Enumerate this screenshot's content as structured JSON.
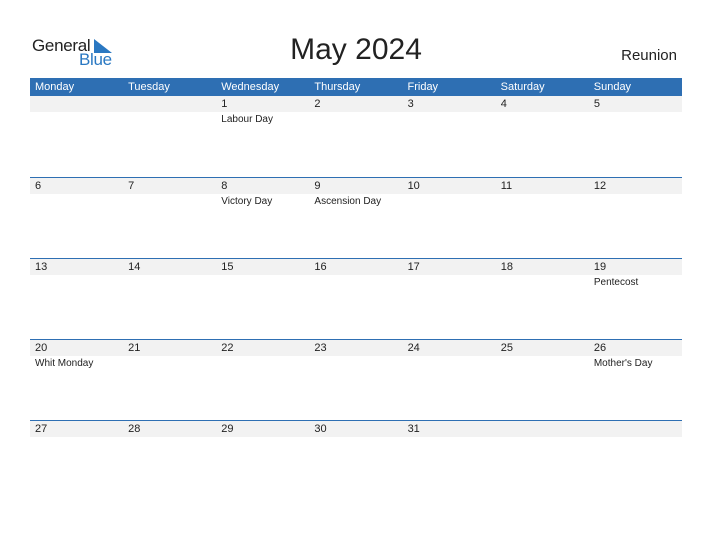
{
  "logo": {
    "general": "General",
    "blue": "Blue"
  },
  "title": "May 2024",
  "country": "Reunion",
  "colors": {
    "accent": "#2e6fb3",
    "logo_blue": "#2a78c2",
    "row_strip": "#f2f2f2"
  },
  "weekdays": [
    "Monday",
    "Tuesday",
    "Wednesday",
    "Thursday",
    "Friday",
    "Saturday",
    "Sunday"
  ],
  "weeks": [
    {
      "days": [
        {
          "num": "",
          "holiday": ""
        },
        {
          "num": "",
          "holiday": ""
        },
        {
          "num": "1",
          "holiday": "Labour Day"
        },
        {
          "num": "2",
          "holiday": ""
        },
        {
          "num": "3",
          "holiday": ""
        },
        {
          "num": "4",
          "holiday": ""
        },
        {
          "num": "5",
          "holiday": ""
        }
      ]
    },
    {
      "days": [
        {
          "num": "6",
          "holiday": ""
        },
        {
          "num": "7",
          "holiday": ""
        },
        {
          "num": "8",
          "holiday": "Victory Day"
        },
        {
          "num": "9",
          "holiday": "Ascension Day"
        },
        {
          "num": "10",
          "holiday": ""
        },
        {
          "num": "11",
          "holiday": ""
        },
        {
          "num": "12",
          "holiday": ""
        }
      ]
    },
    {
      "days": [
        {
          "num": "13",
          "holiday": ""
        },
        {
          "num": "14",
          "holiday": ""
        },
        {
          "num": "15",
          "holiday": ""
        },
        {
          "num": "16",
          "holiday": ""
        },
        {
          "num": "17",
          "holiday": ""
        },
        {
          "num": "18",
          "holiday": ""
        },
        {
          "num": "19",
          "holiday": "Pentecost"
        }
      ]
    },
    {
      "days": [
        {
          "num": "20",
          "holiday": "Whit Monday"
        },
        {
          "num": "21",
          "holiday": ""
        },
        {
          "num": "22",
          "holiday": ""
        },
        {
          "num": "23",
          "holiday": ""
        },
        {
          "num": "24",
          "holiday": ""
        },
        {
          "num": "25",
          "holiday": ""
        },
        {
          "num": "26",
          "holiday": "Mother's Day"
        }
      ]
    },
    {
      "days": [
        {
          "num": "27",
          "holiday": ""
        },
        {
          "num": "28",
          "holiday": ""
        },
        {
          "num": "29",
          "holiday": ""
        },
        {
          "num": "30",
          "holiday": ""
        },
        {
          "num": "31",
          "holiday": ""
        },
        {
          "num": "",
          "holiday": ""
        },
        {
          "num": "",
          "holiday": ""
        }
      ]
    }
  ]
}
